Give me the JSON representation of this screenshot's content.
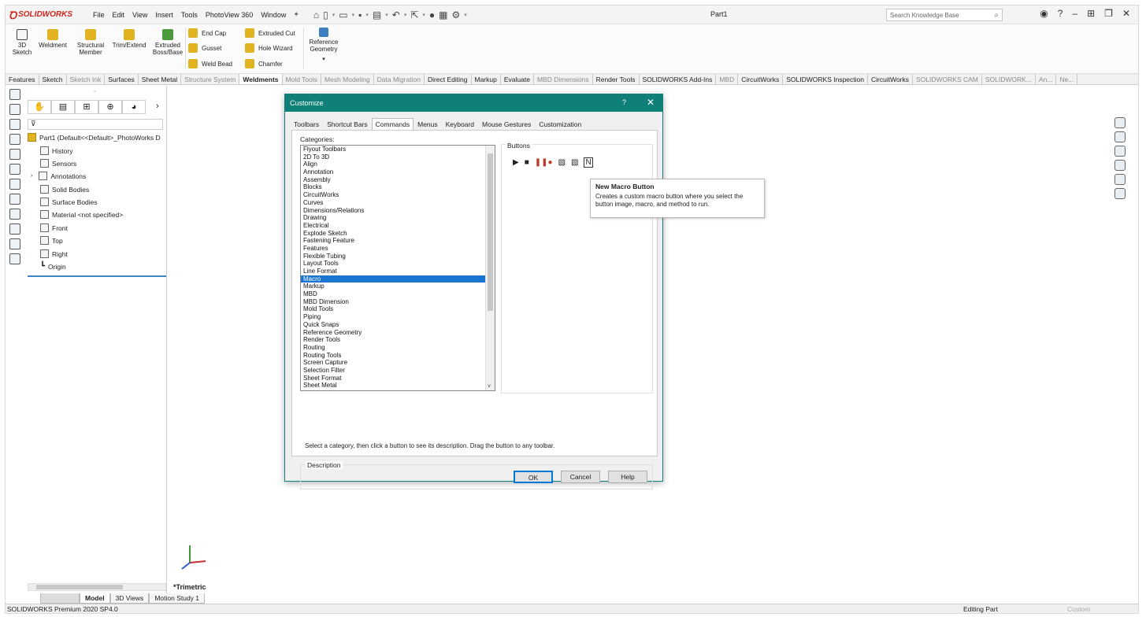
{
  "menubar": {
    "logo": "SOLIDWORKS",
    "items": [
      "File",
      "Edit",
      "View",
      "Insert",
      "Tools",
      "PhotoView 360",
      "Window"
    ],
    "document_title": "Part1",
    "search_placeholder": "Search Knowledge Base"
  },
  "command_manager": {
    "sketch_3d": "3D Sketch",
    "weldment": "Weldment",
    "structural_member": "Structural Member",
    "trim_extend": "Trim/Extend",
    "extruded_boss": "Extruded Boss/Base",
    "end_cap": "End Cap",
    "gusset": "Gusset",
    "weld_bead": "Weld Bead",
    "extruded_cut": "Extruded Cut",
    "hole_wizard": "Hole Wizard",
    "chamfer": "Chamfer",
    "reference_geometry": "Reference Geometry"
  },
  "tabs": [
    {
      "label": "Features",
      "state": "normal"
    },
    {
      "label": "Sketch",
      "state": "normal"
    },
    {
      "label": "Sketch Ink",
      "state": "dim"
    },
    {
      "label": "Surfaces",
      "state": "normal"
    },
    {
      "label": "Sheet Metal",
      "state": "normal"
    },
    {
      "label": "Structure System",
      "state": "dim"
    },
    {
      "label": "Weldments",
      "state": "active"
    },
    {
      "label": "Mold Tools",
      "state": "dim"
    },
    {
      "label": "Mesh Modeling",
      "state": "dim"
    },
    {
      "label": "Data Migration",
      "state": "dim"
    },
    {
      "label": "Direct Editing",
      "state": "normal"
    },
    {
      "label": "Markup",
      "state": "normal"
    },
    {
      "label": "Evaluate",
      "state": "normal"
    },
    {
      "label": "MBD Dimensions",
      "state": "dim"
    },
    {
      "label": "Render Tools",
      "state": "normal"
    },
    {
      "label": "SOLIDWORKS Add-Ins",
      "state": "normal"
    },
    {
      "label": "MBD",
      "state": "dim"
    },
    {
      "label": "CircuitWorks",
      "state": "normal"
    },
    {
      "label": "SOLIDWORKS Inspection",
      "state": "normal"
    },
    {
      "label": "CircuitWorks",
      "state": "normal"
    },
    {
      "label": "SOLIDWORKS CAM",
      "state": "dim"
    },
    {
      "label": "SOLIDWORK...",
      "state": "dim"
    },
    {
      "label": "An...",
      "state": "dim"
    },
    {
      "label": "Ne...",
      "state": "dim"
    }
  ],
  "tree": {
    "root": "Part1  (Default<<Default>_PhotoWorks D",
    "items": [
      "History",
      "Sensors",
      "Annotations",
      "Solid Bodies",
      "Surface Bodies",
      "Material <not specified>",
      "Front",
      "Top",
      "Right",
      "Origin"
    ]
  },
  "dialog": {
    "title": "Customize",
    "help": "?",
    "close": "✕",
    "tabs": [
      "Toolbars",
      "Shortcut Bars",
      "Commands",
      "Menus",
      "Keyboard",
      "Mouse Gestures",
      "Customization"
    ],
    "active_tab": "Commands",
    "categories_label": "Categories:",
    "categories": [
      "Flyout Toolbars",
      "2D To 3D",
      "Align",
      "Annotation",
      "Assembly",
      "Blocks",
      "CircuitWorks",
      "Curves",
      "Dimensions/Relations",
      "Drawing",
      "Electrical",
      "Explode Sketch",
      "Fastening Feature",
      "Features",
      "Flexible Tubing",
      "Layout Tools",
      "Line Format",
      "Macro",
      "Markup",
      "MBD",
      "MBD Dimension",
      "Mold Tools",
      "Piping",
      "Quick Snaps",
      "Reference Geometry",
      "Render Tools",
      "Routing",
      "Routing Tools",
      "Screen Capture",
      "Selection Filter",
      "Sheet Format",
      "Sheet Metal"
    ],
    "selected_category": "Macro",
    "buttons_label": "Buttons",
    "tooltip_title": "New Macro Button",
    "tooltip_text": "Creates a custom macro button where you select the button image, macro, and method to run.",
    "hint": "Select a category, then click a button to see its description. Drag the button to any toolbar.",
    "description_label": "Description",
    "ok": "OK",
    "cancel": "Cancel",
    "help_button": "Help"
  },
  "bottom": {
    "model_tabs": [
      "Model",
      "3D Views",
      "Motion Study 1"
    ],
    "view_label": "*Trimetric",
    "status_left": "SOLIDWORKS Premium 2020 SP4.0",
    "status_mode": "Editing Part",
    "status_custom": "Custom"
  },
  "colors": {
    "dialog_title": "#0f8077",
    "selection": "#1a74d2",
    "logo": "#d0251c"
  }
}
